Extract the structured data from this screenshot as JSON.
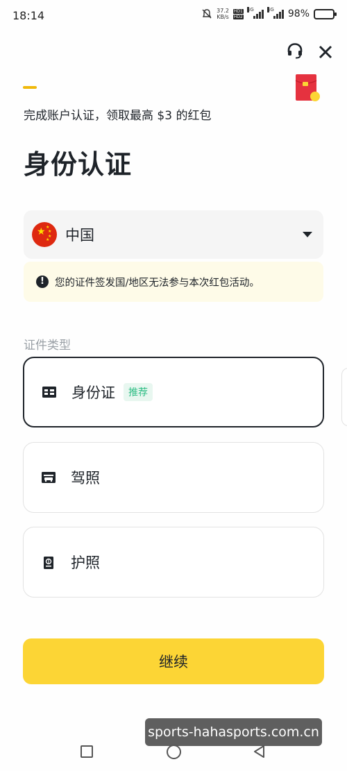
{
  "status_bar": {
    "time": "18:14",
    "net_speed_value": "37.2",
    "net_speed_unit": "KB/s",
    "hd1": "HD1",
    "hd2": "HD2",
    "sig1": "4G",
    "sig2": "4G",
    "battery": "98%"
  },
  "header": {
    "promo": "完成账户认证，领取最高 $3 的红包",
    "title": "身份认证"
  },
  "country": {
    "selected": "中国"
  },
  "warning": {
    "text": "您的证件签发国/地区无法参与本次红包活动。"
  },
  "doc_type": {
    "section_label": "证件类型",
    "options": [
      {
        "label": "身份证",
        "badge": "推荐",
        "icon": "id-card-icon"
      },
      {
        "label": "驾照",
        "icon": "driver-license-icon"
      },
      {
        "label": "护照",
        "icon": "passport-icon"
      }
    ]
  },
  "actions": {
    "continue": "继续"
  },
  "watermark": "sports-hahasports.com.cn",
  "colors": {
    "accent": "#fcd535",
    "progress": "#f0b90b",
    "recommend": "#2ebd85"
  }
}
